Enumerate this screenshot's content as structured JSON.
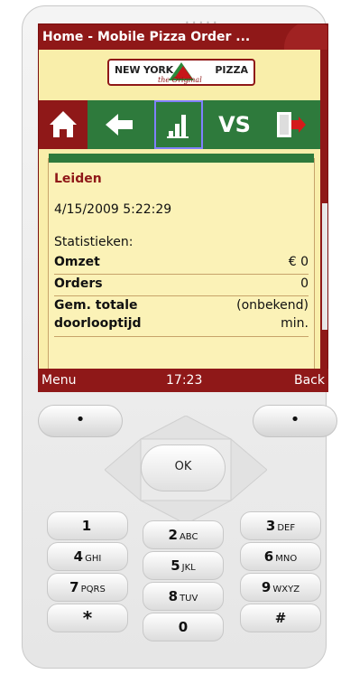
{
  "window": {
    "title": "Home - Mobile Pizza Order ..."
  },
  "logo": {
    "brand_left": "NEW YORK",
    "brand_right": "PIZZA",
    "tagline": "the Original"
  },
  "toolbar": {
    "items": [
      {
        "label": "",
        "icon": "home-icon"
      },
      {
        "label": "",
        "icon": "back-arrow-icon"
      },
      {
        "label": "",
        "icon": "bar-chart-icon"
      },
      {
        "label": "VS",
        "icon": ""
      },
      {
        "label": "",
        "icon": "exit-door-icon"
      }
    ]
  },
  "content": {
    "city": "Leiden",
    "datetime": "4/15/2009 5:22:29",
    "stats_heading": "Statistieken:",
    "omzet_label": "Omzet",
    "omzet_value": "€ 0",
    "orders_label": "Orders",
    "orders_value": "0",
    "gem_label_1": "Gem. totale",
    "gem_label_2": "doorlooptijd",
    "gem_value_1": "(onbekend)",
    "gem_value_2": "min."
  },
  "softkeys": {
    "left": "Menu",
    "time": "17:23",
    "right": "Back"
  },
  "keypad": {
    "ok": "OK",
    "soft_left": "•",
    "soft_right": "•",
    "keys": [
      {
        "num": "1",
        "letters": ""
      },
      {
        "num": "2",
        "letters": "ABC"
      },
      {
        "num": "3",
        "letters": "DEF"
      },
      {
        "num": "4",
        "letters": "GHI"
      },
      {
        "num": "5",
        "letters": "JKL"
      },
      {
        "num": "6",
        "letters": "MNO"
      },
      {
        "num": "7",
        "letters": "PQRS"
      },
      {
        "num": "8",
        "letters": "TUV"
      },
      {
        "num": "9",
        "letters": "WXYZ"
      },
      {
        "num": "*",
        "letters": ""
      },
      {
        "num": "0",
        "letters": ""
      },
      {
        "num": "#",
        "letters": ""
      }
    ]
  },
  "colors": {
    "brand_red": "#8f1818",
    "brand_green": "#2e7a3c",
    "screen_bg": "#f9eeaa"
  }
}
